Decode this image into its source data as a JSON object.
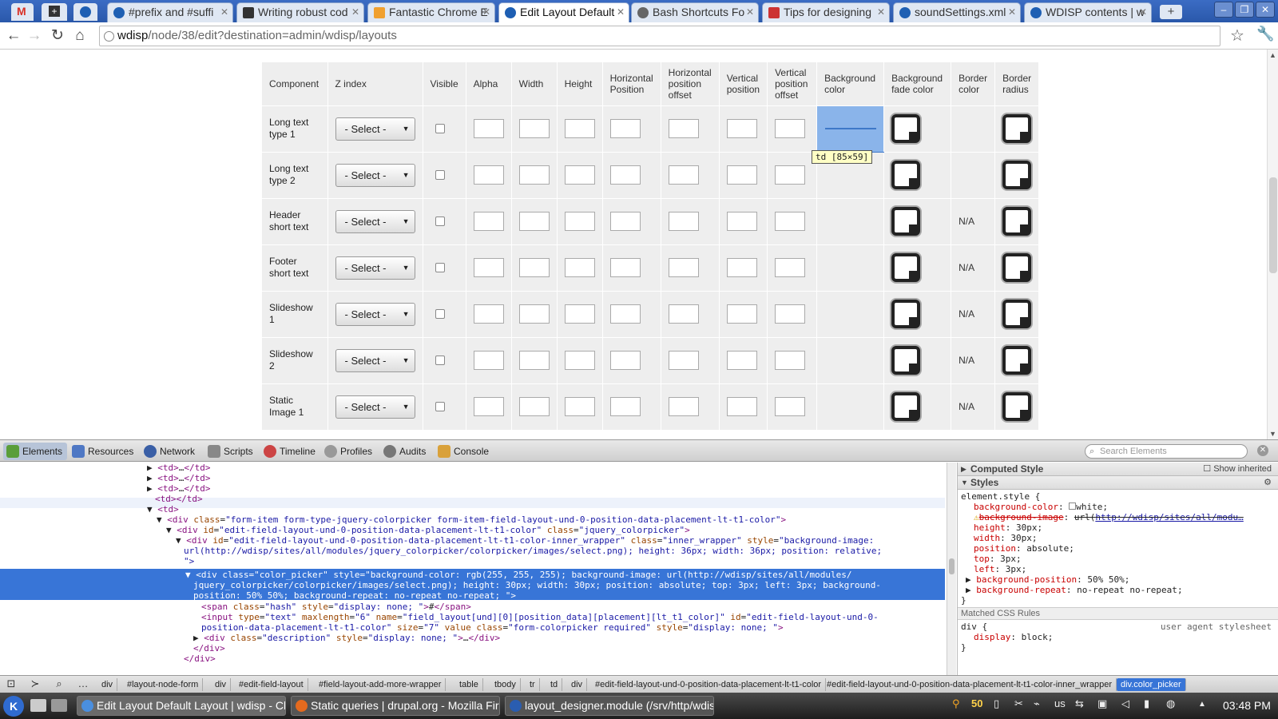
{
  "browser": {
    "tabs": [
      {
        "label": "#prefix and #suffi"
      },
      {
        "label": "Writing robust cod"
      },
      {
        "label": "Fantastic Chrome E"
      },
      {
        "label": "Edit Layout Default"
      },
      {
        "label": "Bash Shortcuts Fo"
      },
      {
        "label": "Tips for designing"
      },
      {
        "label": "soundSettings.xml"
      },
      {
        "label": "WDISP contents | w"
      }
    ],
    "url_host": "wdisp",
    "url_path": "/node/38/edit?destination=admin/wdisp/layouts"
  },
  "table": {
    "headers": [
      "Component",
      "Z index",
      "Visible",
      "Alpha",
      "Width",
      "Height",
      "Horizontal Position",
      "Horizontal position offset",
      "Vertical position",
      "Vertical position offset",
      "Background color",
      "Background fade color",
      "Border color",
      "Border radius"
    ],
    "select_label": "- Select -",
    "na_label": "N/A",
    "rows": [
      {
        "component": "Long text type 1"
      },
      {
        "component": "Long text type 2"
      },
      {
        "component": "Header short text"
      },
      {
        "component": "Footer short text"
      },
      {
        "component": "Slideshow 1"
      },
      {
        "component": "Slideshow 2"
      },
      {
        "component": "Static Image 1"
      }
    ],
    "tooltip": "td [85×59]"
  },
  "devtools": {
    "tabs": [
      "Elements",
      "Resources",
      "Network",
      "Scripts",
      "Timeline",
      "Profiles",
      "Audits",
      "Console"
    ],
    "search_placeholder": "Search Elements",
    "computed_style": "Computed Style",
    "show_inherited": "Show inherited",
    "styles": "Styles",
    "element_style": "element.style {",
    "matched_rules": "Matched CSS Rules",
    "user_agent": "user agent stylesheet",
    "breadcrumbs": [
      "div",
      "#layout-node-form",
      "div",
      "#edit-field-layout",
      "#field-layout-add-more-wrapper",
      "table",
      "tbody",
      "tr",
      "td",
      "div",
      "#edit-field-layout-und-0-position-data-placement-lt-t1-color",
      "#edit-field-layout-und-0-position-data-placement-lt-t1-color-inner_wrapper",
      "div.color_picker"
    ]
  },
  "taskbar": {
    "tasks": [
      "Edit Layout Default Layout | wdisp - Ch",
      "Static queries | drupal.org - Mozilla Fir",
      "layout_designer.module (/srv/http/wdis"
    ],
    "tray_badge": "50",
    "keyboard_layout": "us",
    "clock": "03:48 PM"
  }
}
